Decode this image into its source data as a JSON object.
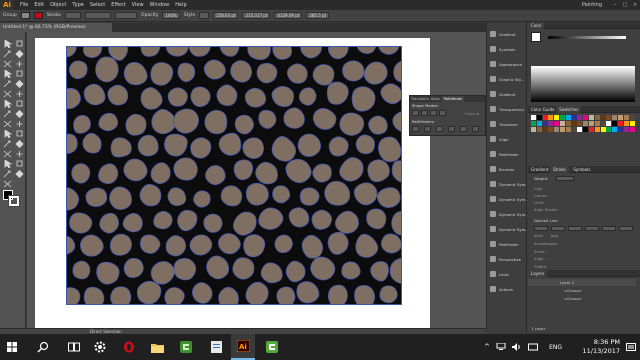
{
  "app": {
    "logo": "Ai",
    "menus": [
      "File",
      "Edit",
      "Object",
      "Type",
      "Select",
      "Effect",
      "View",
      "Window",
      "Help"
    ],
    "workspace": "Painting",
    "window_buttons": [
      "–",
      "□",
      "×"
    ]
  },
  "control_bar": {
    "selection_label": "Group",
    "stroke_label": "Stroke",
    "opacity_label": "Opacity",
    "opacity_value": "100%",
    "style_label": "Style",
    "x_value": "258.63 pt",
    "y_value": "215.317 pt",
    "w_value": "4129.09 pt",
    "h_value": "285.5 pt",
    "stroke_color": "#d0021b"
  },
  "document": {
    "tab_title": "Untitled-1* @ 66.73% (RGB/Preview)"
  },
  "status": {
    "tool": "Direct Selection"
  },
  "icon_strip": {
    "items": [
      "Gradient",
      "Symbols",
      "Appearance",
      "Graphic Sty...",
      "Gradient",
      "Transparency",
      "Transform",
      "Align",
      "Pathfinder",
      "Brushes",
      "Dynamic Sym...",
      "Dynamic Sym...",
      "Dynamic Sym...",
      "Dynamic Sym...",
      "Pathfinder",
      "Perspective",
      "Links",
      "Actions"
    ]
  },
  "float_panel": {
    "tabs": [
      "Transform",
      "Align",
      "Pathfinder"
    ],
    "shape_modes_label": "Shape Modes:",
    "pathfinders_label": "Pathfinders:",
    "expand_label": "Expand"
  },
  "right_panel": {
    "color_tab": "Color",
    "swatch_tabs": [
      "Color Guide",
      "Swatches"
    ],
    "stroke_tabs": [
      "Gradient",
      "Stroke",
      "Symbols"
    ],
    "stroke_rows": [
      "Weight:",
      "Cap:",
      "Corner:",
      "Limit:",
      "Align Stroke:",
      "Dashed Line",
      "dash",
      "gap",
      "Arrowheads:",
      "Scale:",
      "Align:",
      "Profile:"
    ],
    "layers_tab": "Layers",
    "layers": [
      "Layer 1",
      "<Group>",
      "<Group>"
    ],
    "layers_footer": "1 Layer"
  },
  "taskbar": {
    "time": "8:36 PM",
    "date": "11/13/2017",
    "language": "ENG"
  },
  "colors": {
    "stone_fill": "#7e6f62",
    "stone_stroke": "#3f53b5",
    "grout": "#0c0c0c",
    "accent": "#ff9a00"
  }
}
